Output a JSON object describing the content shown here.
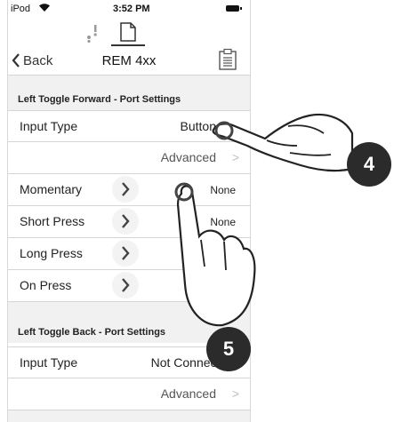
{
  "status_bar": {
    "carrier": "iPod",
    "time": "3:52 PM"
  },
  "nav": {
    "back_label": "Back",
    "title": "REM 4xx"
  },
  "sections": [
    {
      "header": "Left Toggle Forward - Port Settings",
      "input_type_label": "Input Type",
      "input_type_value": "Button",
      "advanced_label": "Advanced",
      "rows": [
        {
          "label": "Momentary",
          "value": "None"
        },
        {
          "label": "Short Press",
          "value": "None"
        },
        {
          "label": "Long Press",
          "value": ""
        },
        {
          "label": "On Press",
          "value": ""
        }
      ]
    },
    {
      "header": "Left Toggle Back - Port Settings",
      "input_type_label": "Input Type",
      "input_type_value": "Not Connected",
      "advanced_label": "Advanced"
    }
  ],
  "callouts": {
    "first": "4",
    "second": "5"
  },
  "icons": {
    "back": "chevron-left-icon",
    "chair": "wheelchair-icon",
    "document": "document-icon",
    "clipboard": "clipboard-icon",
    "row_action": "chevron-right-icon"
  },
  "colors": {
    "section_bg": "#f1f1f1",
    "callout_bg": "#2b2b2b",
    "divider": "#d5d5d5"
  }
}
